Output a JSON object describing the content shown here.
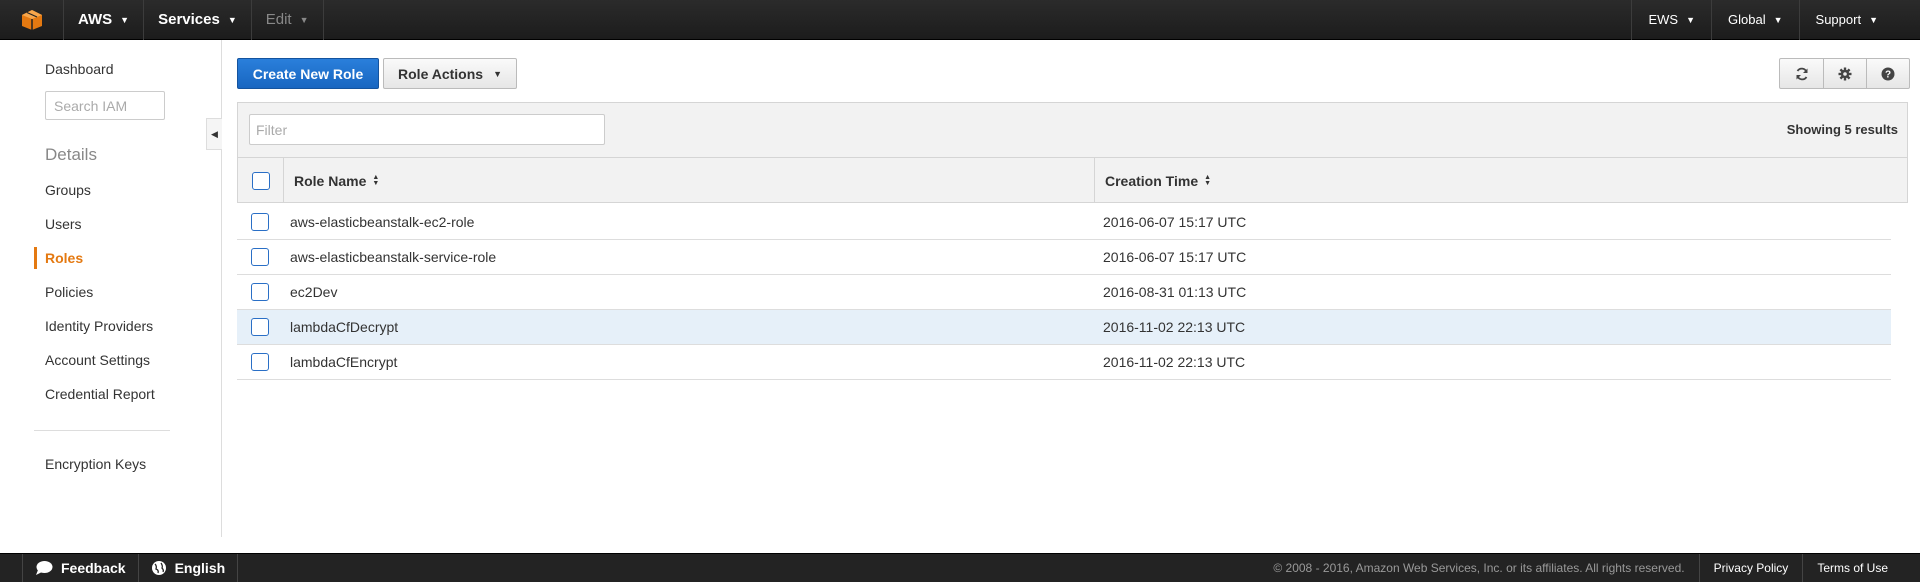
{
  "topnav": {
    "logo_icon": "aws-cube-icon",
    "brand": "AWS",
    "services": "Services",
    "edit": "Edit",
    "account": "EWS",
    "region": "Global",
    "support": "Support"
  },
  "sidebar": {
    "dashboard": "Dashboard",
    "search_placeholder": "Search IAM",
    "heading": "Details",
    "items": [
      {
        "label": "Groups"
      },
      {
        "label": "Users"
      },
      {
        "label": "Roles"
      },
      {
        "label": "Policies"
      },
      {
        "label": "Identity Providers"
      },
      {
        "label": "Account Settings"
      },
      {
        "label": "Credential Report"
      }
    ],
    "encryption": "Encryption Keys",
    "active": "Roles"
  },
  "toolbar": {
    "create_label": "Create New Role",
    "actions_label": "Role Actions",
    "icons": [
      "refresh-icon",
      "gear-icon",
      "help-icon"
    ]
  },
  "table": {
    "filter_placeholder": "Filter",
    "result_count": "Showing 5 results",
    "columns": [
      "Role Name",
      "Creation Time"
    ],
    "rows": [
      {
        "name": "aws-elasticbeanstalk-ec2-role",
        "time": "2016-06-07 15:17 UTC"
      },
      {
        "name": "aws-elasticbeanstalk-service-role",
        "time": "2016-06-07 15:17 UTC"
      },
      {
        "name": "ec2Dev",
        "time": "2016-08-31 01:13 UTC"
      },
      {
        "name": "lambdaCfDecrypt",
        "time": "2016-11-02 22:13 UTC"
      },
      {
        "name": "lambdaCfEncrypt",
        "time": "2016-11-02 22:13 UTC"
      }
    ],
    "highlighted_row": 3
  },
  "footer": {
    "feedback": "Feedback",
    "language": "English",
    "copyright": "© 2008 - 2016, Amazon Web Services, Inc. or its affiliates. All rights reserved.",
    "privacy": "Privacy Policy",
    "terms": "Terms of Use"
  },
  "colors": {
    "accent": "#e47911",
    "primary": "#1f73cf",
    "topbar": "#232323"
  }
}
